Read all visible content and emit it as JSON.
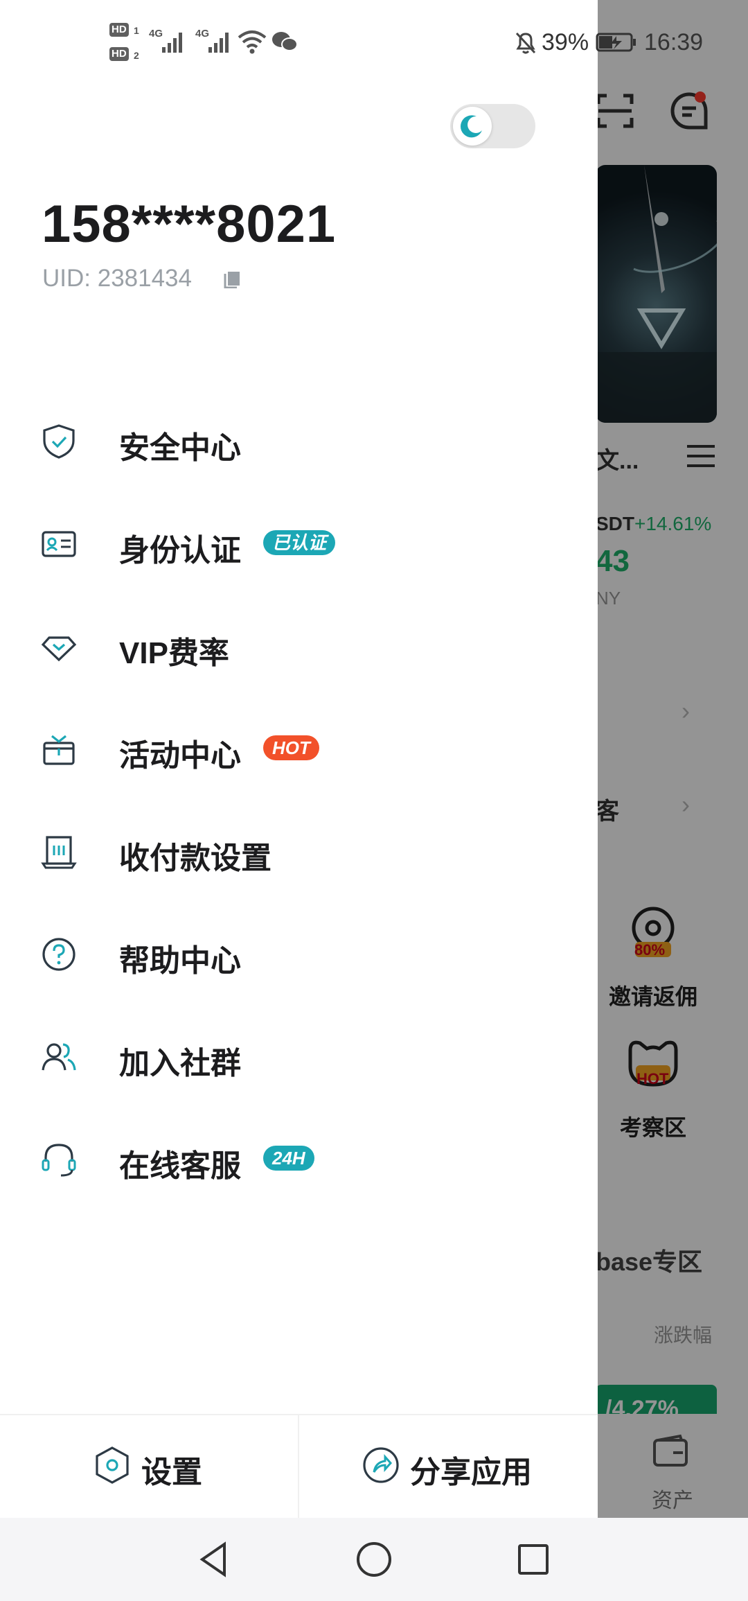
{
  "status_bar": {
    "hd1": "HD",
    "hd1_sub": "1",
    "hd2": "HD",
    "hd2_sub": "2",
    "net1": "4G",
    "net2": "4G",
    "battery": "39%",
    "time": "16:39"
  },
  "drawer": {
    "theme_mode": "dark-toggle-off",
    "phone": "158****8021",
    "uid": "UID: 2381434",
    "menu": [
      {
        "label": "安全中心",
        "icon": "shield-check-icon"
      },
      {
        "label": "身份认证",
        "icon": "id-card-icon",
        "badge": "已认证"
      },
      {
        "label": "VIP费率",
        "icon": "diamond-icon"
      },
      {
        "label": "活动中心",
        "icon": "gift-box-icon",
        "badge": "HOT"
      },
      {
        "label": "收付款设置",
        "icon": "payment-settings-icon"
      },
      {
        "label": "帮助中心",
        "icon": "help-circle-icon"
      },
      {
        "label": "加入社群",
        "icon": "community-icon"
      },
      {
        "label": "在线客服",
        "icon": "headset-icon",
        "badge": "24H"
      }
    ],
    "footer": {
      "settings_label": "设置",
      "share_label": "分享应用"
    }
  },
  "background": {
    "banner_text": "文...",
    "pair": "SDT",
    "change": "+14.61%",
    "price": "43",
    "currency": "NY",
    "row2_text": "客",
    "feature1_badge": "80%",
    "feature1_label": "邀请返佣",
    "feature2_badge": "HOT",
    "feature2_label": "考察区",
    "zone_title": "base专区",
    "sort_label": "涨跌幅",
    "green_value": "/4.27%",
    "tab_label": "资产"
  },
  "colors": {
    "accent": "#1ca7b5",
    "hot": "#f2512a",
    "text": "#1c1c1e",
    "muted": "#9aa0a6"
  }
}
